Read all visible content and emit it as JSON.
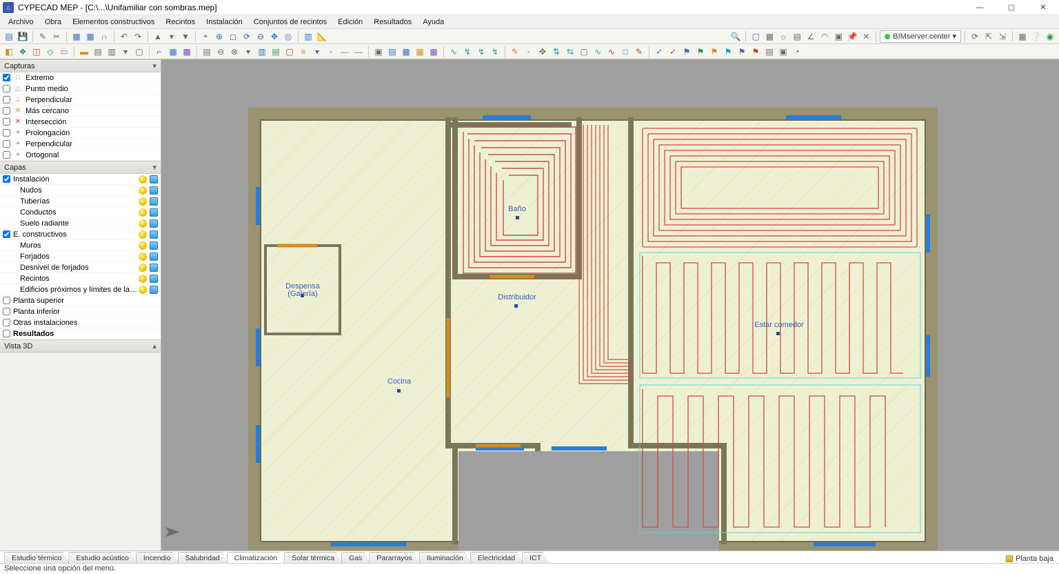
{
  "window": {
    "title": "CYPECAD MEP - [C:\\...\\Unifamiliar con sombras.mep]",
    "appicon_text": "⌂"
  },
  "menu": [
    "Archivo",
    "Obra",
    "Elementos constructivos",
    "Recintos",
    "Instalación",
    "Conjuntos de recintos",
    "Edición",
    "Resultados",
    "Ayuda"
  ],
  "bimserver": "BIMserver.center ▾",
  "panels": {
    "capturas": {
      "title": "Capturas",
      "items": [
        {
          "checked": true,
          "sym": "□",
          "symcolor": "#d88a1f",
          "label": "Extremo"
        },
        {
          "checked": false,
          "sym": "△",
          "symcolor": "#d88a1f",
          "label": "Punto medio"
        },
        {
          "checked": false,
          "sym": "⊥",
          "symcolor": "#d88a1f",
          "label": "Perpendicular"
        },
        {
          "checked": false,
          "sym": "✕",
          "symcolor": "#d88a1f",
          "label": "Más cercano"
        },
        {
          "checked": false,
          "sym": "✕",
          "symcolor": "#c73a2c",
          "label": "Intersección"
        },
        {
          "checked": false,
          "sym": "+",
          "symcolor": "#666",
          "label": "Prolongación"
        },
        {
          "checked": false,
          "sym": "+",
          "symcolor": "#666",
          "label": "Perpendicular"
        },
        {
          "checked": false,
          "sym": "+",
          "symcolor": "#666",
          "label": "Ortogonal"
        }
      ]
    },
    "capas": {
      "title": "Capas",
      "items": [
        {
          "checked": true,
          "indent": 0,
          "label": "Instalación",
          "bulb": true,
          "cube": true
        },
        {
          "checked": null,
          "indent": 1,
          "label": "Nudos",
          "bulb": true,
          "cube": true
        },
        {
          "checked": null,
          "indent": 1,
          "label": "Tuberías",
          "bulb": true,
          "cube": true
        },
        {
          "checked": null,
          "indent": 1,
          "label": "Conductos",
          "bulb": true,
          "cube": true
        },
        {
          "checked": null,
          "indent": 1,
          "label": "Suelo radiante",
          "bulb": true,
          "cube": true
        },
        {
          "checked": true,
          "indent": 0,
          "label": "E. constructivos",
          "bulb": true,
          "cube": true
        },
        {
          "checked": null,
          "indent": 1,
          "label": "Muros",
          "bulb": true,
          "cube": true
        },
        {
          "checked": null,
          "indent": 1,
          "label": "Forjados",
          "bulb": true,
          "cube": true
        },
        {
          "checked": null,
          "indent": 1,
          "label": "Desnivel de forjados",
          "bulb": true,
          "cube": true
        },
        {
          "checked": null,
          "indent": 1,
          "label": "Recintos",
          "bulb": true,
          "cube": true
        },
        {
          "checked": null,
          "indent": 1,
          "label": "Edificios próximos y límites de la propiedad",
          "bulb": true,
          "cube": true
        },
        {
          "checked": false,
          "indent": 0,
          "label": "Planta superior"
        },
        {
          "checked": false,
          "indent": 0,
          "label": "Planta inferior"
        },
        {
          "checked": false,
          "indent": 0,
          "label": "Otras instalaciones"
        },
        {
          "checked": false,
          "indent": 0,
          "label": "Resultados",
          "bold": true
        }
      ]
    },
    "vista3d": {
      "title": "Vista 3D"
    }
  },
  "rooms": {
    "despensa_l1": "Despensa",
    "despensa_l2": "(Galería)",
    "bano": "Baño",
    "distribuidor": "Distribuidor",
    "cocina": "Cocina",
    "estar": "Estar comedor"
  },
  "bottom_tabs": [
    "Estudio térmico",
    "Estudio acústico",
    "Incendio",
    "Salubridad",
    "Climatización",
    "Solar térmica",
    "Gas",
    "Pararrayos",
    "Iluminación",
    "Electricidad",
    "ICT"
  ],
  "active_bottom_tab": 4,
  "floor_label": "Planta baja",
  "status": "Seleccione una opción del menú."
}
